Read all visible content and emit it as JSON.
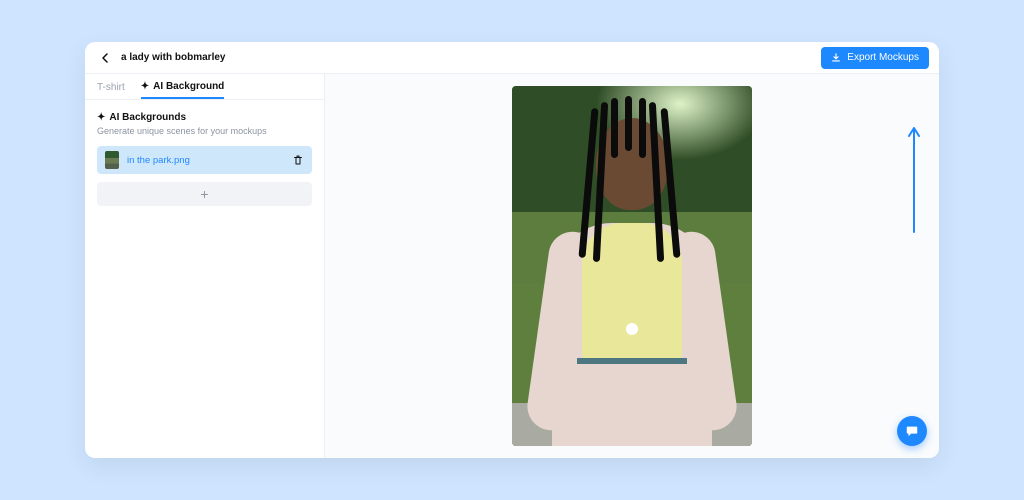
{
  "header": {
    "title": "a lady with bobmarley",
    "export_label": "Export Mockups"
  },
  "tabs": {
    "tshirt": "T-shirt",
    "ai_bg": "AI Background"
  },
  "panel": {
    "heading": "AI Backgrounds",
    "subheading": "Generate unique scenes for your mockups",
    "file_name": "in the park.png",
    "add_label": "+"
  },
  "icons": {
    "sparkle": "✦"
  },
  "colors": {
    "accent": "#1e88ff",
    "selected_bg": "#cfe7fb"
  }
}
